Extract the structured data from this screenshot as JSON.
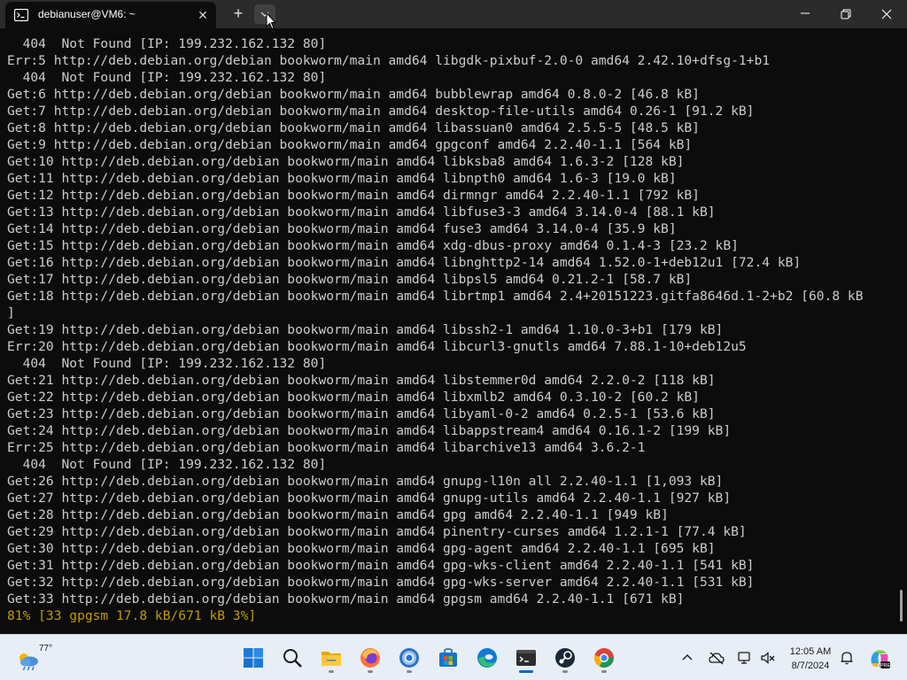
{
  "window": {
    "tab_title": "debianuser@VM6: ~",
    "tab_icon": "terminal-icon",
    "close_tab_symbol": "✕",
    "new_tab_symbol": "+"
  },
  "terminal": {
    "lines": [
      "  404  Not Found [IP: 199.232.162.132 80]",
      "Err:5 http://deb.debian.org/debian bookworm/main amd64 libgdk-pixbuf-2.0-0 amd64 2.42.10+dfsg-1+b1",
      "  404  Not Found [IP: 199.232.162.132 80]",
      "Get:6 http://deb.debian.org/debian bookworm/main amd64 bubblewrap amd64 0.8.0-2 [46.8 kB]",
      "Get:7 http://deb.debian.org/debian bookworm/main amd64 desktop-file-utils amd64 0.26-1 [91.2 kB]",
      "Get:8 http://deb.debian.org/debian bookworm/main amd64 libassuan0 amd64 2.5.5-5 [48.5 kB]",
      "Get:9 http://deb.debian.org/debian bookworm/main amd64 gpgconf amd64 2.2.40-1.1 [564 kB]",
      "Get:10 http://deb.debian.org/debian bookworm/main amd64 libksba8 amd64 1.6.3-2 [128 kB]",
      "Get:11 http://deb.debian.org/debian bookworm/main amd64 libnpth0 amd64 1.6-3 [19.0 kB]",
      "Get:12 http://deb.debian.org/debian bookworm/main amd64 dirmngr amd64 2.2.40-1.1 [792 kB]",
      "Get:13 http://deb.debian.org/debian bookworm/main amd64 libfuse3-3 amd64 3.14.0-4 [88.1 kB]",
      "Get:14 http://deb.debian.org/debian bookworm/main amd64 fuse3 amd64 3.14.0-4 [35.9 kB]",
      "Get:15 http://deb.debian.org/debian bookworm/main amd64 xdg-dbus-proxy amd64 0.1.4-3 [23.2 kB]",
      "Get:16 http://deb.debian.org/debian bookworm/main amd64 libnghttp2-14 amd64 1.52.0-1+deb12u1 [72.4 kB]",
      "Get:17 http://deb.debian.org/debian bookworm/main amd64 libpsl5 amd64 0.21.2-1 [58.7 kB]",
      "Get:18 http://deb.debian.org/debian bookworm/main amd64 librtmp1 amd64 2.4+20151223.gitfa8646d.1-2+b2 [60.8 kB",
      "]",
      "Get:19 http://deb.debian.org/debian bookworm/main amd64 libssh2-1 amd64 1.10.0-3+b1 [179 kB]",
      "Err:20 http://deb.debian.org/debian bookworm/main amd64 libcurl3-gnutls amd64 7.88.1-10+deb12u5",
      "  404  Not Found [IP: 199.232.162.132 80]",
      "Get:21 http://deb.debian.org/debian bookworm/main amd64 libstemmer0d amd64 2.2.0-2 [118 kB]",
      "Get:22 http://deb.debian.org/debian bookworm/main amd64 libxmlb2 amd64 0.3.10-2 [60.2 kB]",
      "Get:23 http://deb.debian.org/debian bookworm/main amd64 libyaml-0-2 amd64 0.2.5-1 [53.6 kB]",
      "Get:24 http://deb.debian.org/debian bookworm/main amd64 libappstream4 amd64 0.16.1-2 [199 kB]",
      "Err:25 http://deb.debian.org/debian bookworm/main amd64 libarchive13 amd64 3.6.2-1",
      "  404  Not Found [IP: 199.232.162.132 80]",
      "Get:26 http://deb.debian.org/debian bookworm/main amd64 gnupg-l10n all 2.2.40-1.1 [1,093 kB]",
      "Get:27 http://deb.debian.org/debian bookworm/main amd64 gnupg-utils amd64 2.2.40-1.1 [927 kB]",
      "Get:28 http://deb.debian.org/debian bookworm/main amd64 gpg amd64 2.2.40-1.1 [949 kB]",
      "Get:29 http://deb.debian.org/debian bookworm/main amd64 pinentry-curses amd64 1.2.1-1 [77.4 kB]",
      "Get:30 http://deb.debian.org/debian bookworm/main amd64 gpg-agent amd64 2.2.40-1.1 [695 kB]",
      "Get:31 http://deb.debian.org/debian bookworm/main amd64 gpg-wks-client amd64 2.2.40-1.1 [541 kB]",
      "Get:32 http://deb.debian.org/debian bookworm/main amd64 gpg-wks-server amd64 2.2.40-1.1 [531 kB]",
      "Get:33 http://deb.debian.org/debian bookworm/main amd64 gpgsm amd64 2.2.40-1.1 [671 kB]"
    ],
    "progress_line": "81% [33 gpgsm 17.8 kB/671 kB 3%]",
    "progress_color": "#c19c00",
    "text_color": "#cccccc",
    "background_color": "#0c0c0c"
  },
  "taskbar": {
    "weather_temp": "77°",
    "weather_icon": "partly-sunny-rain-icon",
    "apps": [
      {
        "name": "start-button",
        "icon": "windows-logo-icon"
      },
      {
        "name": "search-button",
        "icon": "search-icon"
      },
      {
        "name": "file-explorer-button",
        "icon": "folder-icon"
      },
      {
        "name": "firefox-button",
        "icon": "firefox-icon"
      },
      {
        "name": "chrome-button",
        "icon": "chrome-icon"
      },
      {
        "name": "microsoft-store-button",
        "icon": "store-icon"
      },
      {
        "name": "edge-button",
        "icon": "edge-icon"
      },
      {
        "name": "terminal-button",
        "icon": "terminal-icon",
        "active": true
      },
      {
        "name": "steam-button",
        "icon": "steam-icon"
      },
      {
        "name": "chrome-button-2",
        "icon": "chrome-icon"
      }
    ],
    "clock_time": "12:05 AM",
    "clock_date": "8/7/2024",
    "accent_color": "#0067c0"
  }
}
